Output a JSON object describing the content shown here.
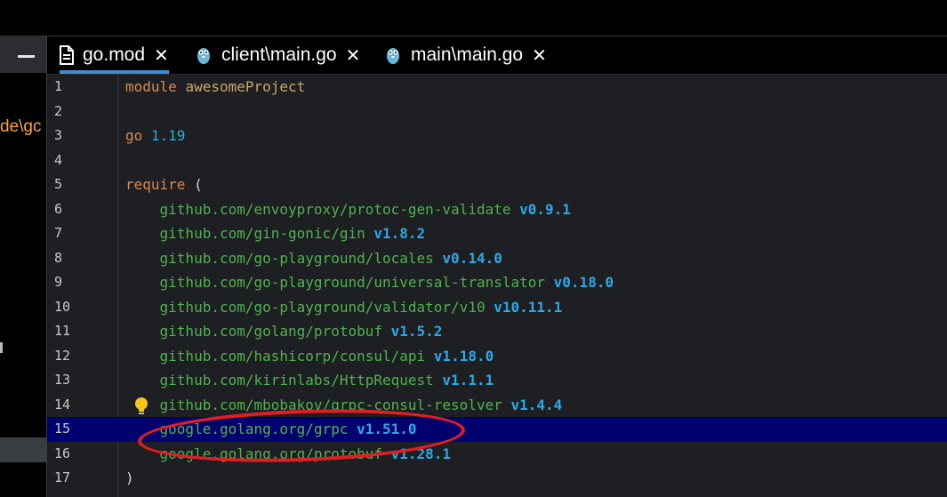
{
  "left_panel": {
    "path_text": "de\\gc"
  },
  "tabs": [
    {
      "label": "go.mod",
      "icon": "file-icon",
      "active": true,
      "close": "✕"
    },
    {
      "label": "client\\main.go",
      "icon": "gopher-icon",
      "active": false,
      "close": "✕"
    },
    {
      "label": "main\\main.go",
      "icon": "gopher-icon",
      "active": false,
      "close": "✕"
    }
  ],
  "editor": {
    "highlighted_line": 15,
    "lines": [
      {
        "n": "1",
        "parts": [
          [
            "kw",
            "module"
          ],
          [
            "punc",
            " "
          ],
          [
            "id",
            "awesomeProject"
          ]
        ]
      },
      {
        "n": "2",
        "parts": []
      },
      {
        "n": "3",
        "parts": [
          [
            "kw",
            "go"
          ],
          [
            "punc",
            " "
          ],
          [
            "num",
            "1.19"
          ]
        ]
      },
      {
        "n": "4",
        "parts": []
      },
      {
        "n": "5",
        "parts": [
          [
            "kw",
            "require"
          ],
          [
            "punc",
            " ("
          ]
        ]
      },
      {
        "n": "6",
        "parts": [
          [
            "punc",
            "    "
          ],
          [
            "str",
            "github.com/envoyproxy/protoc-gen-validate"
          ],
          [
            "punc",
            " "
          ],
          [
            "ver",
            "v0.9.1"
          ]
        ]
      },
      {
        "n": "7",
        "parts": [
          [
            "punc",
            "    "
          ],
          [
            "str",
            "github.com/gin-gonic/gin"
          ],
          [
            "punc",
            " "
          ],
          [
            "ver",
            "v1.8.2"
          ]
        ]
      },
      {
        "n": "8",
        "parts": [
          [
            "punc",
            "    "
          ],
          [
            "str",
            "github.com/go-playground/locales"
          ],
          [
            "punc",
            " "
          ],
          [
            "ver",
            "v0.14.0"
          ]
        ]
      },
      {
        "n": "9",
        "parts": [
          [
            "punc",
            "    "
          ],
          [
            "str",
            "github.com/go-playground/universal-translator"
          ],
          [
            "punc",
            " "
          ],
          [
            "ver",
            "v0.18.0"
          ]
        ]
      },
      {
        "n": "10",
        "parts": [
          [
            "punc",
            "    "
          ],
          [
            "str",
            "github.com/go-playground/validator/v10"
          ],
          [
            "punc",
            " "
          ],
          [
            "ver",
            "v10.11.1"
          ]
        ]
      },
      {
        "n": "11",
        "parts": [
          [
            "punc",
            "    "
          ],
          [
            "str",
            "github.com/golang/protobuf"
          ],
          [
            "punc",
            " "
          ],
          [
            "ver",
            "v1.5.2"
          ]
        ]
      },
      {
        "n": "12",
        "parts": [
          [
            "punc",
            "    "
          ],
          [
            "str",
            "github.com/hashicorp/consul/api"
          ],
          [
            "punc",
            " "
          ],
          [
            "ver",
            "v1.18.0"
          ]
        ]
      },
      {
        "n": "13",
        "parts": [
          [
            "punc",
            "    "
          ],
          [
            "str",
            "github.com/kirinlabs/HttpRequest"
          ],
          [
            "punc",
            " "
          ],
          [
            "ver",
            "v1.1.1"
          ]
        ]
      },
      {
        "n": "14",
        "parts": [
          [
            "punc",
            "    "
          ],
          [
            "str",
            "github.com/mbobakov/grpc-consul-resolver"
          ],
          [
            "punc",
            " "
          ],
          [
            "ver",
            "v1.4.4"
          ]
        ]
      },
      {
        "n": "15",
        "parts": [
          [
            "punc",
            "    "
          ],
          [
            "str",
            "google.golang.org/grpc"
          ],
          [
            "punc",
            " "
          ],
          [
            "ver",
            "v1.51.0"
          ]
        ]
      },
      {
        "n": "16",
        "parts": [
          [
            "punc",
            "    "
          ],
          [
            "str",
            "google.golang.org/protobuf"
          ],
          [
            "punc",
            " "
          ],
          [
            "ver",
            "v1.28.1"
          ]
        ]
      },
      {
        "n": "17",
        "parts": [
          [
            "punc",
            ")"
          ]
        ]
      }
    ]
  },
  "colors": {
    "accent": "#3d8fd1",
    "highlight_row": "#00006e",
    "annotation": "#e01e24"
  }
}
